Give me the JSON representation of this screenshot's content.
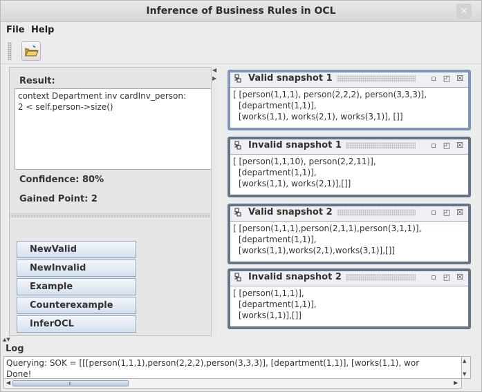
{
  "window": {
    "title": "Inference of Business Rules in OCL",
    "close_glyph": "×"
  },
  "menu": {
    "items": [
      {
        "label": "File"
      },
      {
        "label": "Help"
      }
    ]
  },
  "toolbar": {
    "open_icon": "folder-open-icon"
  },
  "left": {
    "result_label": "Result:",
    "result_lines": [
      "context Department inv cardInv_person:",
      "2 < self.person->size()"
    ],
    "confidence": "Confidence: 80%",
    "gained": "Gained Point: 2",
    "buttons": [
      {
        "label": "NewValid"
      },
      {
        "label": "NewInvalid"
      },
      {
        "label": "Example"
      },
      {
        "label": "Counterexample"
      },
      {
        "label": "InferOCL"
      }
    ]
  },
  "snapshots": [
    {
      "title": "Valid snapshot 1",
      "lines": [
        "[ [person(1,1,1), person(2,2,2), person(3,3,3)],",
        "[department(1,1)],",
        "[works(1,1), works(2,1), works(3,1)], []]"
      ]
    },
    {
      "title": "Invalid snapshot 1",
      "lines": [
        "[ [person(1,1,10), person(2,2,11)],",
        "[department(1,1)],",
        "[works(1,1), works(2,1)],[]]"
      ]
    },
    {
      "title": "Valid snapshot 2",
      "lines": [
        "[ [person(1,1,1),person(2,1,1),person(3,1,1)],",
        "[department(1,1)],",
        "[works(1,1),works(2,1),works(3,1)],[]]"
      ]
    },
    {
      "title": "Invalid snapshot 2",
      "lines": [
        "[ [person(1,1,1)],",
        "[department(1,1)],",
        "[works(1,1)],[]]"
      ]
    }
  ],
  "log": {
    "label": "Log",
    "lines": [
      "Querying: SOK = [[[person(1,1,1),person(2,2,2),person(3,3,3)], [department(1,1)], [works(1,1), wor",
      "Done!"
    ]
  },
  "colors": {
    "active_frame": "#7d95b8",
    "frame_border": "#637388",
    "button_border": "#8aa8c9"
  }
}
